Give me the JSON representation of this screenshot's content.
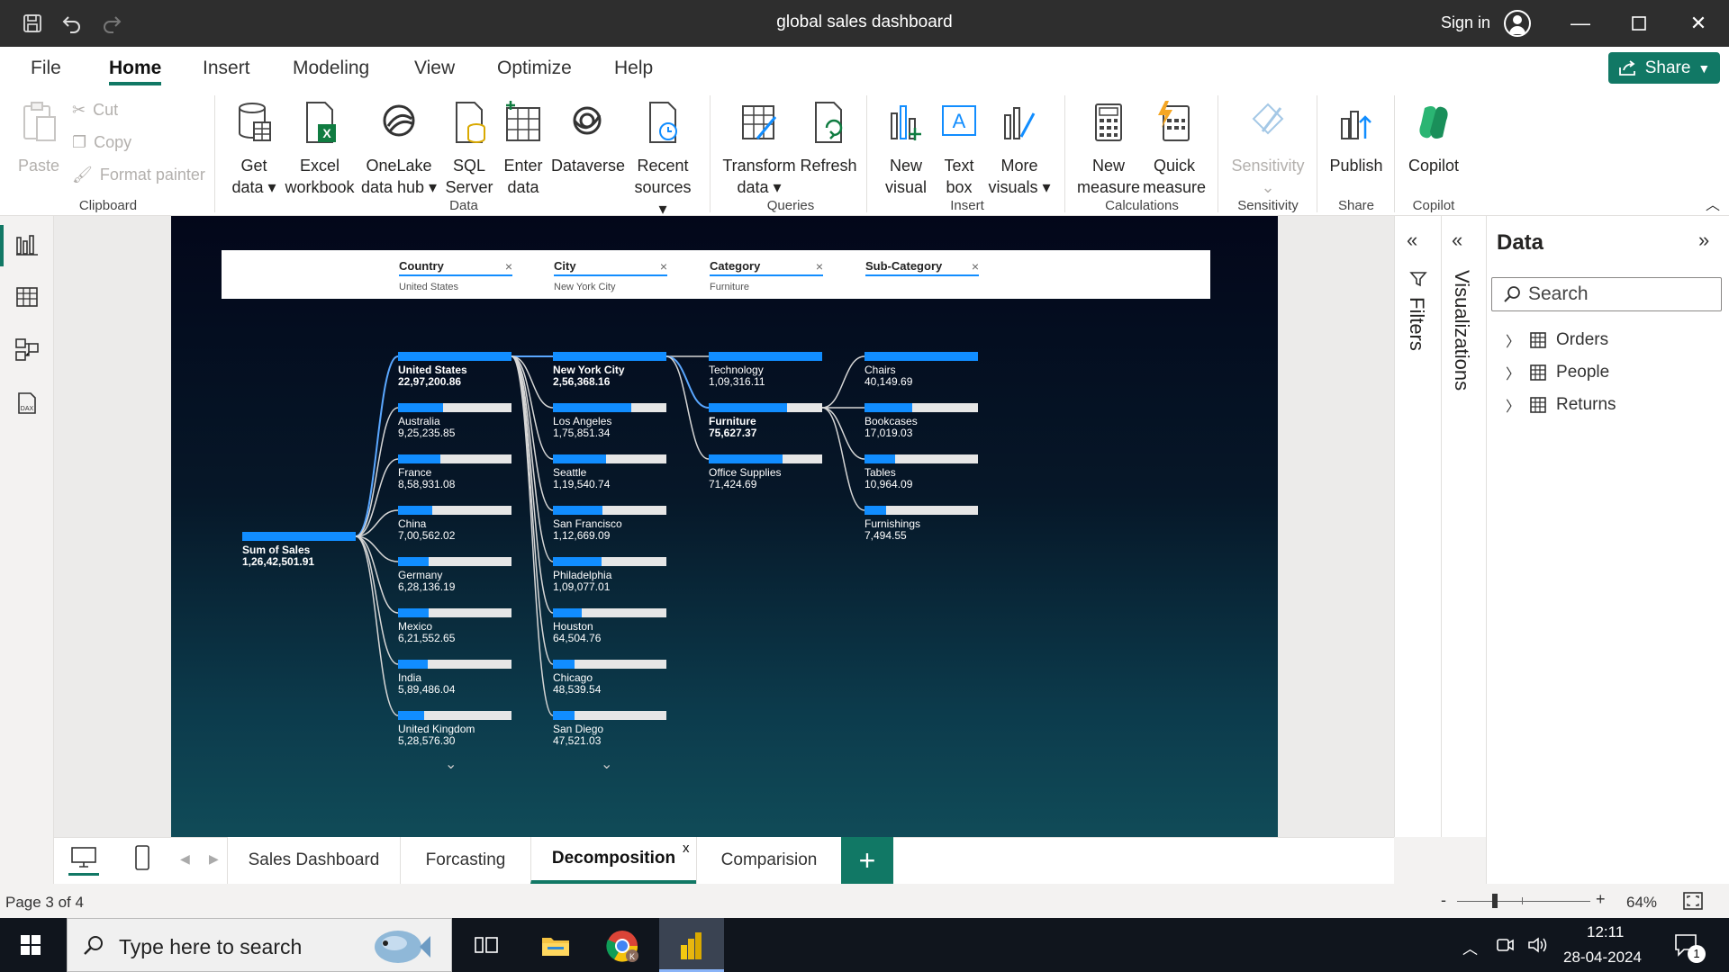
{
  "app": {
    "title": "global sales dashboard",
    "sign_in": "Sign in",
    "share": "Share"
  },
  "menu": [
    "File",
    "Home",
    "Insert",
    "Modeling",
    "View",
    "Optimize",
    "Help"
  ],
  "ribbon": {
    "clipboard": {
      "paste": "Paste",
      "cut": "Cut",
      "copy": "Copy",
      "format_painter": "Format painter",
      "group": "Clipboard"
    },
    "data": {
      "get_data": [
        "Get",
        "data"
      ],
      "excel": [
        "Excel",
        "workbook"
      ],
      "onelake": [
        "OneLake",
        "data hub"
      ],
      "sql": [
        "SQL",
        "Server"
      ],
      "enter": [
        "Enter",
        "data"
      ],
      "dataverse": "Dataverse",
      "recent": [
        "Recent",
        "sources"
      ],
      "group": "Data"
    },
    "queries": {
      "transform": [
        "Transform",
        "data"
      ],
      "refresh": "Refresh",
      "group": "Queries"
    },
    "insert": {
      "new_visual": [
        "New",
        "visual"
      ],
      "text_box": [
        "Text",
        "box"
      ],
      "more_visuals": [
        "More",
        "visuals"
      ],
      "group": "Insert"
    },
    "calculations": {
      "new_measure": [
        "New",
        "measure"
      ],
      "quick_measure": [
        "Quick",
        "measure"
      ],
      "group": "Calculations"
    },
    "sensitivity": {
      "label": "Sensitivity",
      "group": "Sensitivity"
    },
    "share": {
      "publish": "Publish",
      "group": "Share"
    },
    "copilot": {
      "label": "Copilot",
      "group": "Copilot"
    }
  },
  "slicers": [
    {
      "label": "Country",
      "value": "United States"
    },
    {
      "label": "City",
      "value": "New York City"
    },
    {
      "label": "Category",
      "value": "Furniture"
    },
    {
      "label": "Sub-Category",
      "value": ""
    }
  ],
  "tree": {
    "root": {
      "name": "Sum of Sales",
      "value": "1,26,42,501.91"
    },
    "countries": [
      {
        "name": "United States",
        "value": "22,97,200.86",
        "share": 1.0
      },
      {
        "name": "Australia",
        "value": "9,25,235.85",
        "share": 0.4
      },
      {
        "name": "France",
        "value": "8,58,931.08",
        "share": 0.37
      },
      {
        "name": "China",
        "value": "7,00,562.02",
        "share": 0.3
      },
      {
        "name": "Germany",
        "value": "6,28,136.19",
        "share": 0.27
      },
      {
        "name": "Mexico",
        "value": "6,21,552.65",
        "share": 0.27
      },
      {
        "name": "India",
        "value": "5,89,486.04",
        "share": 0.26
      },
      {
        "name": "United Kingdom",
        "value": "5,28,576.30",
        "share": 0.23
      }
    ],
    "cities": [
      {
        "name": "New York City",
        "value": "2,56,368.16",
        "share": 1.0
      },
      {
        "name": "Los Angeles",
        "value": "1,75,851.34",
        "share": 0.69
      },
      {
        "name": "Seattle",
        "value": "1,19,540.74",
        "share": 0.47
      },
      {
        "name": "San Francisco",
        "value": "1,12,669.09",
        "share": 0.44
      },
      {
        "name": "Philadelphia",
        "value": "1,09,077.01",
        "share": 0.43
      },
      {
        "name": "Houston",
        "value": "64,504.76",
        "share": 0.25
      },
      {
        "name": "Chicago",
        "value": "48,539.54",
        "share": 0.19
      },
      {
        "name": "San Diego",
        "value": "47,521.03",
        "share": 0.19
      }
    ],
    "categories": [
      {
        "name": "Technology",
        "value": "1,09,316.11",
        "share": 1.0
      },
      {
        "name": "Furniture",
        "value": "75,627.37",
        "share": 0.69
      },
      {
        "name": "Office Supplies",
        "value": "71,424.69",
        "share": 0.65
      }
    ],
    "subcategories": [
      {
        "name": "Chairs",
        "value": "40,149.69",
        "share": 1.0
      },
      {
        "name": "Bookcases",
        "value": "17,019.03",
        "share": 0.42
      },
      {
        "name": "Tables",
        "value": "10,964.09",
        "share": 0.27
      },
      {
        "name": "Furnishings",
        "value": "7,494.55",
        "share": 0.19
      }
    ]
  },
  "panes": {
    "filters": "Filters",
    "visualizations": "Visualizations",
    "data": "Data",
    "search_placeholder": "Search",
    "tables": [
      "Orders",
      "People",
      "Returns"
    ]
  },
  "pages": [
    "Sales Dashboard",
    "Forcasting",
    "Decomposition",
    "Comparision"
  ],
  "status": {
    "page": "Page 3 of 4",
    "zoom": "64%"
  },
  "taskbar": {
    "search": "Type here to search",
    "time": "12:11",
    "date": "28-04-2024",
    "notif": "1"
  },
  "colors": {
    "accent": "#117865",
    "bar": "#118dff"
  }
}
